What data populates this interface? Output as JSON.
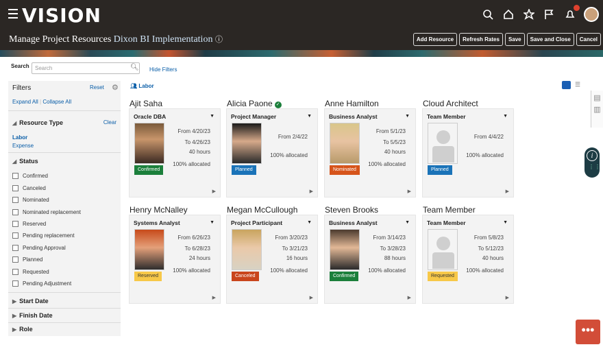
{
  "app": {
    "logo": "VISION"
  },
  "header": {
    "title": "Manage Project Resources",
    "project": "Dixon BI Implementation",
    "buttons": {
      "add": "Add Resource",
      "refresh": "Refresh Rates",
      "save": "Save",
      "save_close": "Save and Close",
      "cancel": "Cancel"
    }
  },
  "search": {
    "label": "Search",
    "placeholder": "Search",
    "hide_filters": "Hide Filters"
  },
  "filters": {
    "title": "Filters",
    "reset": "Reset",
    "expand_all": "Expand All",
    "collapse_all": "Collapse All",
    "resource_type": {
      "label": "Resource Type",
      "clear": "Clear",
      "options": [
        "Labor",
        "Expense"
      ]
    },
    "status": {
      "label": "Status",
      "options": [
        "Confirmed",
        "Canceled",
        "Nominated",
        "Nominated replacement",
        "Reserved",
        "Pending replacement",
        "Pending Approval",
        "Planned",
        "Requested",
        "Pending Adjustment"
      ]
    },
    "collapsed": [
      "Start Date",
      "Finish Date",
      "Role"
    ]
  },
  "breadcrumb": {
    "labor": "Labor"
  },
  "cards": [
    {
      "name": "Ajit Saha",
      "role": "Oracle DBA",
      "from": "From 4/20/23",
      "to": "To 4/26/23",
      "hours": "40 hours",
      "alloc": "100% allocated",
      "status": "Confirmed"
    },
    {
      "name": "Alicia Paone",
      "role": "Project Manager",
      "from": "From 2/4/22",
      "to": "",
      "hours": "",
      "alloc": "100% allocated",
      "status": "Planned"
    },
    {
      "name": "Anne Hamilton",
      "role": "Business Analyst",
      "from": "From 5/1/23",
      "to": "To 5/5/23",
      "hours": "40 hours",
      "alloc": "100% allocated",
      "status": "Nominated"
    },
    {
      "name": "Cloud Architect",
      "role": "Team Member",
      "from": "From 4/4/22",
      "to": "",
      "hours": "",
      "alloc": "100% allocated",
      "status": "Planned"
    },
    {
      "name": "Henry McNalley",
      "role": "Systems Analyst",
      "from": "From 6/26/23",
      "to": "To 6/28/23",
      "hours": "24 hours",
      "alloc": "100% allocated",
      "status": "Reserved"
    },
    {
      "name": "Megan McCullough",
      "role": "Project Participant",
      "from": "From 3/20/23",
      "to": "To 3/21/23",
      "hours": "16 hours",
      "alloc": "100% allocated",
      "status": "Canceled"
    },
    {
      "name": "Steven Brooks",
      "role": "Business Analyst",
      "from": "From 3/14/23",
      "to": "To 3/28/23",
      "hours": "88 hours",
      "alloc": "100% allocated",
      "status": "Confirmed"
    },
    {
      "name": "Team Member",
      "role": "Team Member",
      "from": "From 5/8/23",
      "to": "To 5/12/23",
      "hours": "40 hours",
      "alloc": "100% allocated",
      "status": "Requested"
    }
  ]
}
